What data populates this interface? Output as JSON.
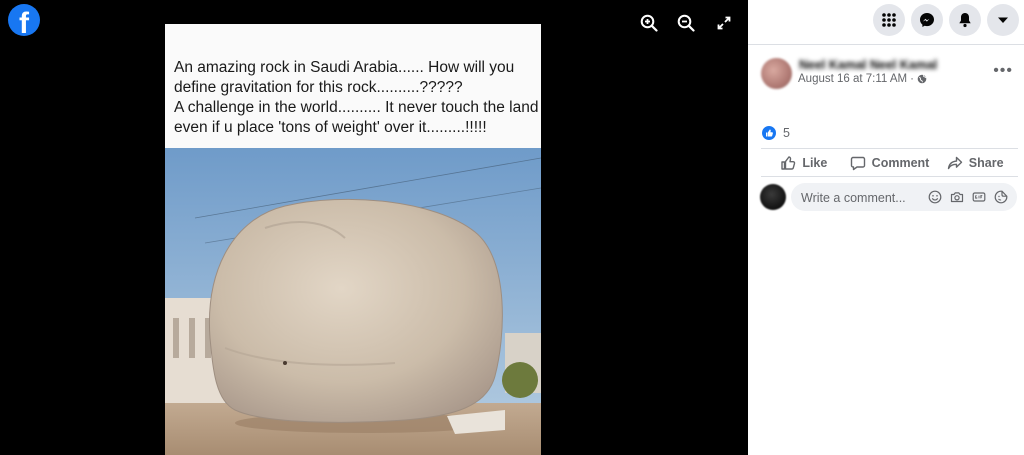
{
  "viewer": {
    "logo_letter": "f",
    "tools": [
      "zoom-in",
      "zoom-out",
      "fullscreen"
    ]
  },
  "photo": {
    "caption": "An amazing rock in Saudi Arabia...... How will you define gravitation for this rock..........?????\nA challenge in the world.......... It never touch the land even if u place 'tons of weight' over it.........!!!!!"
  },
  "header": {
    "icons": [
      "menu-grid-icon",
      "messenger-icon",
      "notifications-icon",
      "account-dropdown-icon"
    ]
  },
  "post": {
    "author": "Neel Kamal Neel Kamal",
    "date": "August 16 at 7:11 AM",
    "privacy_sep": "·",
    "more_label": "•••",
    "reaction_count": "5",
    "actions": {
      "like": "Like",
      "comment": "Comment",
      "share": "Share"
    }
  },
  "comment": {
    "placeholder": "Write a comment..."
  },
  "colors": {
    "brand": "#1877f2",
    "panel_bg": "#ffffff",
    "viewer_bg": "#000000",
    "secondary_text": "#65676b"
  }
}
